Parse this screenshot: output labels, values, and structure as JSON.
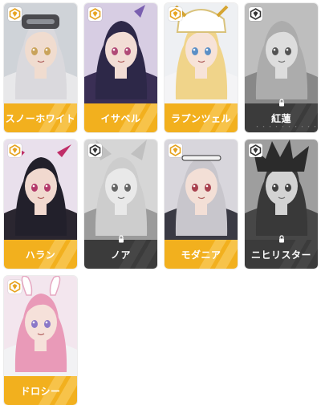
{
  "colors": {
    "unlocked_bar": "#f2b01e",
    "unlocked_stripe": "#f7c34a",
    "locked_bar": "#3b3b3b",
    "badge_unlocked": "#e6a321",
    "badge_locked": "#333333"
  },
  "characters": [
    {
      "name": "スノーホワイト",
      "locked": false,
      "hair": "#dad9dd",
      "skin": "#f0dccf",
      "bg": "#cfd3d8",
      "outfit": "#e8e8ea",
      "eye": "#c9a35a",
      "icon": "visor-helmet"
    },
    {
      "name": "イサベル",
      "locked": false,
      "hair": "#2d2848",
      "skin": "#f2ddd5",
      "bg": "#d7cde3",
      "outfit": "#3a2f55",
      "eye": "#b04a77",
      "icon": "hair-ornament"
    },
    {
      "name": "ラプンツェル",
      "locked": false,
      "hair": "#f0d48a",
      "skin": "#f7e3d8",
      "bg": "#eef0f3",
      "outfit": "#f4f4f6",
      "eye": "#5a8fc6",
      "icon": "nun-veil"
    },
    {
      "name": "紅蓮",
      "locked": true,
      "hair": "#aaaaaa",
      "skin": "#d9d9d9",
      "bg": "#bbbbbb",
      "outfit": "#888888",
      "eye": "#555555",
      "icon": "none",
      "dots": "・・・・・・・・・・・・"
    },
    {
      "name": "ハラン",
      "locked": false,
      "hair": "#22202b",
      "skin": "#f1d9cf",
      "bg": "#e9e0ec",
      "outfit": "#2a2630",
      "eye": "#b33a6a",
      "icon": "horns"
    },
    {
      "name": "ノア",
      "locked": true,
      "hair": "#c9c9c9",
      "skin": "#e4e4e4",
      "bg": "#d2d2d2",
      "outfit": "#9a9a9a",
      "eye": "#666666",
      "icon": "animal-ears"
    },
    {
      "name": "モダニア",
      "locked": false,
      "hair": "#c8c6cc",
      "skin": "#f3dfd6",
      "bg": "#d8d6dc",
      "outfit": "#3a3a44",
      "eye": "#a8414f",
      "icon": "headband"
    },
    {
      "name": "ニヒリスター",
      "locked": true,
      "hair": "#3c3c3c",
      "skin": "#cfcfcf",
      "bg": "#9d9d9d",
      "outfit": "#4a4a4a",
      "eye": "#444444",
      "icon": "spiky-hair"
    },
    {
      "name": "ドロシー",
      "locked": false,
      "hair": "#e99ab8",
      "skin": "#f6e1da",
      "bg": "#f3e6ee",
      "outfit": "#f2f2f4",
      "eye": "#8b78c8",
      "icon": "bunny-ears"
    }
  ]
}
